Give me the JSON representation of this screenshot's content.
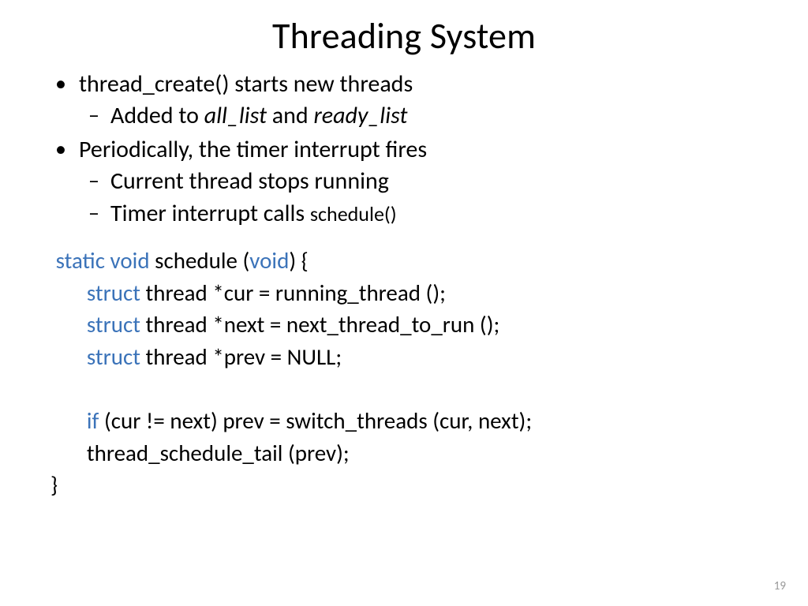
{
  "title": "Threading System",
  "bullets": {
    "b1": "thread_create() starts new threads",
    "b1a_pre": "Added to ",
    "b1a_i1": "all_list",
    "b1a_mid": " and ",
    "b1a_i2": "ready_list",
    "b2": "Periodically, the timer interrupt fires",
    "b2a": "Current thread stops running",
    "b2b_pre": "Timer interrupt calls ",
    "b2b_sm": "schedule()"
  },
  "code": {
    "l1_kw": "static void",
    "l1_rest": " schedule (",
    "l1_kw2": "void",
    "l1_end": ") {",
    "l2_kw": "struct",
    "l2_rest": " thread *cur = running_thread ();",
    "l3_kw": "struct",
    "l3_rest": " thread *next = next_thread_to_run ();",
    "l4_kw": "struct",
    "l4_rest": " thread *prev = NULL;",
    "l5_kw": "if",
    "l5_rest": " (cur != next) prev = switch_threads (cur, next);",
    "l6": "thread_schedule_tail (prev);",
    "l7": "}"
  },
  "pagenum": "19"
}
